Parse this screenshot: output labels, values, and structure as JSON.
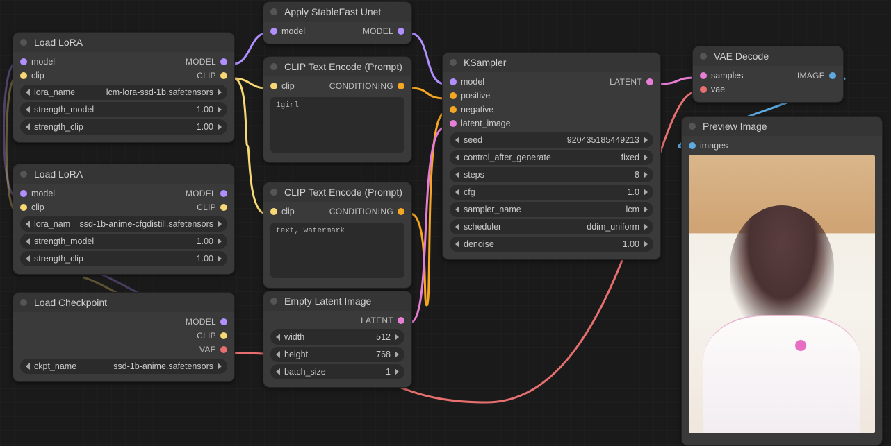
{
  "nodes": {
    "lora1": {
      "title": "Load LoRA",
      "in_model": "model",
      "in_clip": "clip",
      "out_model": "MODEL",
      "out_clip": "CLIP",
      "w_lora_name": {
        "name": "lora_name",
        "value": "lcm-lora-ssd-1b.safetensors"
      },
      "w_strength_model": {
        "name": "strength_model",
        "value": "1.00"
      },
      "w_strength_clip": {
        "name": "strength_clip",
        "value": "1.00"
      }
    },
    "lora2": {
      "title": "Load LoRA",
      "in_model": "model",
      "in_clip": "clip",
      "out_model": "MODEL",
      "out_clip": "CLIP",
      "w_lora_name": {
        "name": "lora_nam",
        "value": "ssd-1b-anime-cfgdistill.safetensors"
      },
      "w_strength_model": {
        "name": "strength_model",
        "value": "1.00"
      },
      "w_strength_clip": {
        "name": "strength_clip",
        "value": "1.00"
      }
    },
    "ckpt": {
      "title": "Load Checkpoint",
      "out_model": "MODEL",
      "out_clip": "CLIP",
      "out_vae": "VAE",
      "w_ckpt_name": {
        "name": "ckpt_name",
        "value": "ssd-1b-anime.safetensors"
      }
    },
    "sfunet": {
      "title": "Apply StableFast Unet",
      "in_model": "model",
      "out_model": "MODEL"
    },
    "clip_pos": {
      "title": "CLIP Text Encode (Prompt)",
      "in_clip": "clip",
      "out_cond": "CONDITIONING",
      "text": "1girl"
    },
    "clip_neg": {
      "title": "CLIP Text Encode (Prompt)",
      "in_clip": "clip",
      "out_cond": "CONDITIONING",
      "text": "text, watermark"
    },
    "empty_latent": {
      "title": "Empty Latent Image",
      "out_latent": "LATENT",
      "w_width": {
        "name": "width",
        "value": "512"
      },
      "w_height": {
        "name": "height",
        "value": "768"
      },
      "w_batch": {
        "name": "batch_size",
        "value": "1"
      }
    },
    "ksampler": {
      "title": "KSampler",
      "in_model": "model",
      "in_positive": "positive",
      "in_negative": "negative",
      "in_latent": "latent_image",
      "out_latent": "LATENT",
      "w_seed": {
        "name": "seed",
        "value": "920435185449213"
      },
      "w_control": {
        "name": "control_after_generate",
        "value": "fixed"
      },
      "w_steps": {
        "name": "steps",
        "value": "8"
      },
      "w_cfg": {
        "name": "cfg",
        "value": "1.0"
      },
      "w_sampler": {
        "name": "sampler_name",
        "value": "lcm"
      },
      "w_scheduler": {
        "name": "scheduler",
        "value": "ddim_uniform"
      },
      "w_denoise": {
        "name": "denoise",
        "value": "1.00"
      }
    },
    "vae_decode": {
      "title": "VAE Decode",
      "in_samples": "samples",
      "in_vae": "vae",
      "out_image": "IMAGE"
    },
    "preview": {
      "title": "Preview Image",
      "in_images": "images"
    }
  },
  "port_colors": {
    "model": "#b28fff",
    "clip": "#f7d774",
    "conditioning": "#f5a623",
    "latent": "#e77ed6",
    "vae": "#e76f6f",
    "image": "#5ea9e0"
  }
}
